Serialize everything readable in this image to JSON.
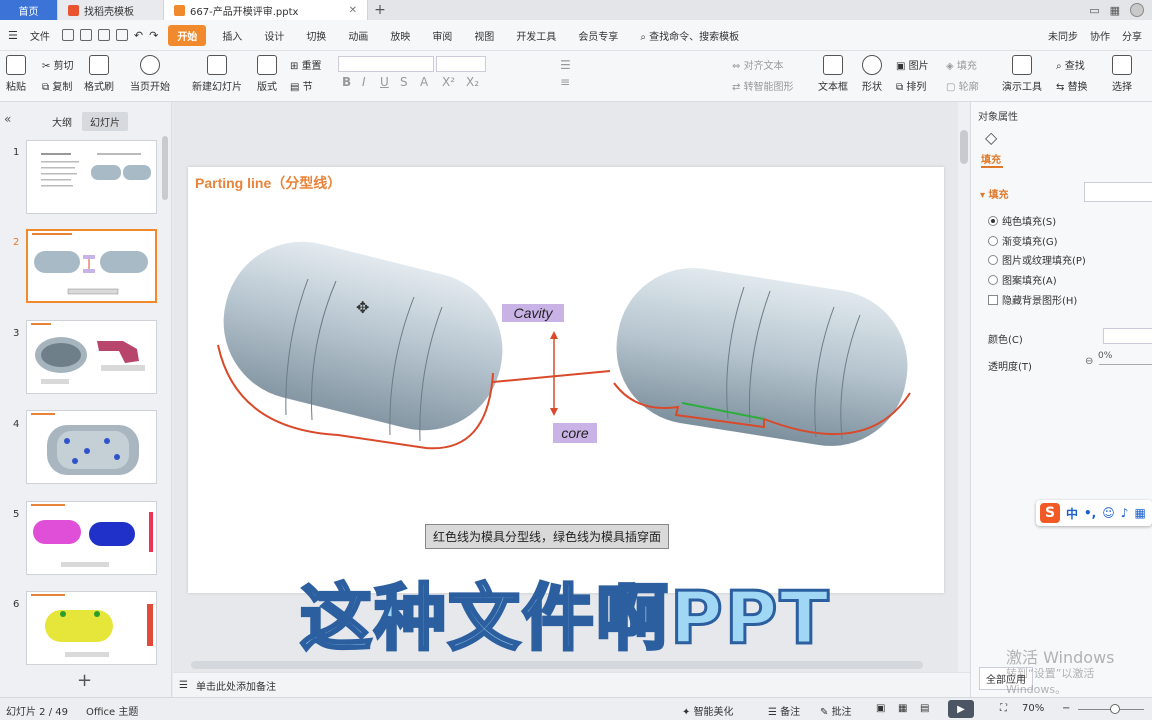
{
  "titlebar": {
    "tabs": [
      {
        "label": "首页",
        "kind": "home"
      },
      {
        "label": "找稻壳模板",
        "kind": "normal"
      },
      {
        "label": "667-产品开模评审.pptx",
        "kind": "active"
      }
    ],
    "add_tab": "+"
  },
  "menubar": {
    "file": "文件",
    "tabs": [
      "开始",
      "插入",
      "设计",
      "切换",
      "动画",
      "放映",
      "审阅",
      "视图",
      "开发工具",
      "会员专享"
    ],
    "search": "查找命令、搜索模板",
    "right": [
      "未同步",
      "协作",
      "分享"
    ]
  },
  "ribbon": {
    "paste": "粘贴",
    "cut": "剪切",
    "copy": "复制",
    "format_painter": "格式刷",
    "from_current": "当页开始",
    "new_slide": "新建幻灯片",
    "layout": "版式",
    "section": "节",
    "reset": "重置",
    "text_direction": "对齐文本",
    "smart_art": "转智能图形",
    "textbox": "文本框",
    "shape": "形状",
    "picture": "图片",
    "fill": "填充",
    "arrange": "排列",
    "outline": "轮廓",
    "presentation_tools": "演示工具",
    "find": "查找",
    "replace": "替换",
    "select": "选择"
  },
  "leftpanel": {
    "tab_outline": "大纲",
    "tab_slides": "幻灯片",
    "slides": [
      {
        "num": "1",
        "selected": false
      },
      {
        "num": "2",
        "selected": true
      },
      {
        "num": "3",
        "selected": false
      },
      {
        "num": "4",
        "selected": false
      },
      {
        "num": "5",
        "selected": false
      },
      {
        "num": "6",
        "selected": false
      }
    ],
    "add": "+"
  },
  "slide": {
    "title": "Parting line（分型线）",
    "label_cavity": "Cavity",
    "label_core": "core",
    "caption": "红色线为模具分型线，绿色线为模具插穿面"
  },
  "notes": {
    "placeholder": "单击此处添加备注"
  },
  "rightpanel": {
    "title": "对象属性",
    "tab": "填充",
    "section": "填充",
    "options": [
      {
        "label": "纯色填充(S)",
        "checked": true
      },
      {
        "label": "渐变填充(G)",
        "checked": false
      },
      {
        "label": "图片或纹理填充(P)",
        "checked": false
      },
      {
        "label": "图案填充(A)",
        "checked": false
      }
    ],
    "hide_bg": "隐藏背景图形(H)",
    "color_label": "颜色(C)",
    "transparency_label": "透明度(T)",
    "transparency_value": "0%",
    "apply_all": "全部应用"
  },
  "ime": {
    "lang": "中"
  },
  "watermark": {
    "line1": "激活 Windows",
    "line2": "转到“设置”以激活 Windows。"
  },
  "statusbar": {
    "slide_pos": "幻灯片 2 / 49",
    "theme": "Office 主题",
    "beautify": "智能美化",
    "notes": "备注",
    "comments": "批注",
    "zoom": "70%"
  },
  "overlay_text": "这种文件啊PPT",
  "colors": {
    "accent": "#f08a2c",
    "title_orange": "#e8833a",
    "parting_red": "#d94a2b",
    "insert_green": "#2fae3f",
    "label_purple": "#c9b3e6"
  }
}
